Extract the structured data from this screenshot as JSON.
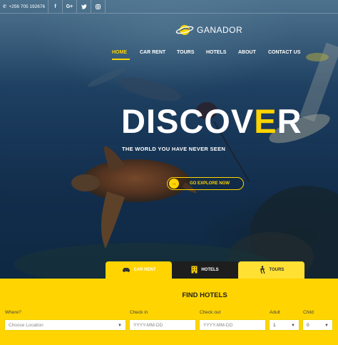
{
  "topbar": {
    "phone": "+256 705 192676",
    "icons": [
      "facebook-icon",
      "google-plus-icon",
      "twitter-icon",
      "instagram-icon"
    ],
    "gplus_label": "G+"
  },
  "brand": {
    "name": "GANADOR"
  },
  "nav": {
    "items": [
      {
        "label": "HOME"
      },
      {
        "label": "CAR RENT"
      },
      {
        "label": "TOURS"
      },
      {
        "label": "HOTELS"
      },
      {
        "label": "ABOUT"
      },
      {
        "label": "CONTACT US"
      }
    ]
  },
  "hero": {
    "headline_pre": "DISCOV",
    "headline_hl": "E",
    "headline_post": "R",
    "tagline": "THE WORLD YOU HAVE NEVER SEEN",
    "cta": "GO EXPLORE NOW"
  },
  "tabs": [
    {
      "label": "CAR RENT"
    },
    {
      "label": "HOTELS"
    },
    {
      "label": "TOURS"
    }
  ],
  "search": {
    "title": "FIND HOTELS",
    "where_label": "Where?",
    "where_value": "Choose Location",
    "checkin_label": "Check in",
    "checkin_placeholder": "YYYY-MM-DD",
    "checkout_label": "Check out",
    "checkout_placeholder": "YYYY-MM-DD",
    "adult_label": "Adult",
    "adult_value": "1",
    "child_label": "Child",
    "child_value": "0"
  },
  "colors": {
    "accent": "#ffd400",
    "dark_tab": "#1e1e1e"
  }
}
